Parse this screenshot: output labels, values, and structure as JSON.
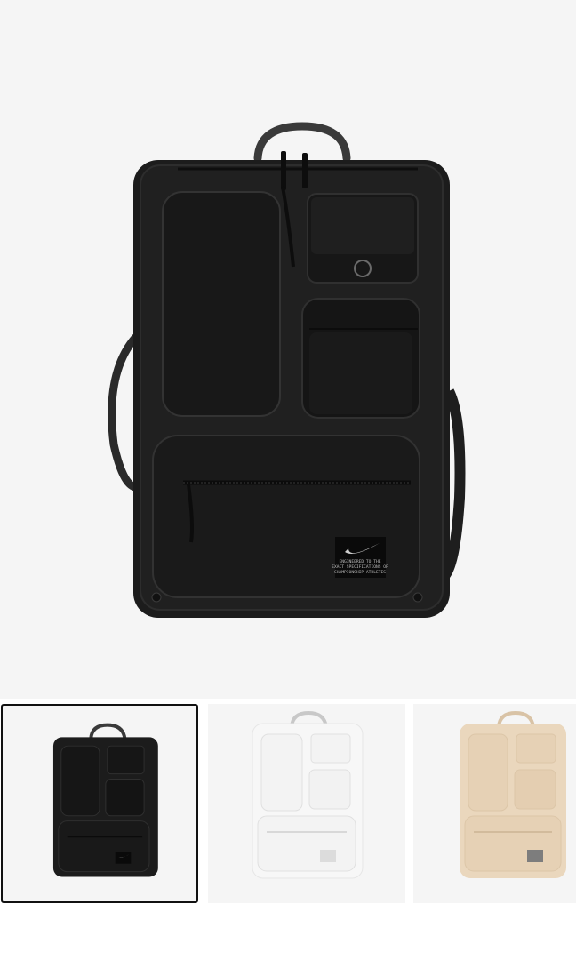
{
  "product": {
    "main_image": "backpack-black-front",
    "colors": {
      "background": "#f5f5f5",
      "selected_border": "#111111"
    },
    "patch": {
      "lines": [
        "ENGINEERED TO THE",
        "EXACT SPECIFICATIONS OF",
        "CHAMPIONSHIP ATHLETES"
      ]
    }
  },
  "thumbnails": [
    {
      "variant": "black",
      "color": "#1c1c1c",
      "selected": true
    },
    {
      "variant": "white",
      "color": "#f2f2f2",
      "selected": false
    },
    {
      "variant": "beige",
      "color": "#ead7bd",
      "selected": false
    }
  ]
}
